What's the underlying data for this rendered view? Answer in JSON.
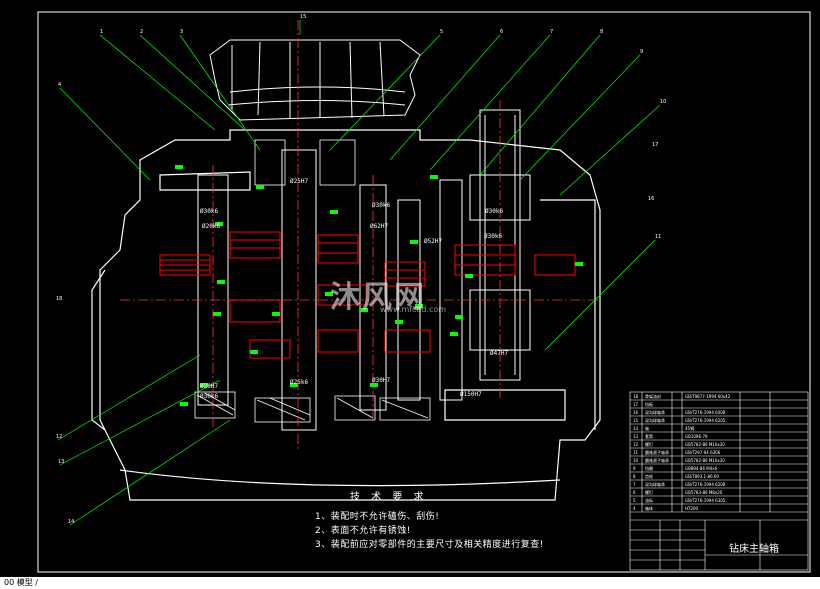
{
  "drawing": {
    "title": "钻床主轴箱",
    "tech_requirements_title": "技 术 要 求",
    "tech_requirements": [
      "1、装配时不允许磕伤、刮伤!",
      "2、表面不允许有锈蚀!",
      "3、装配前应对零部件的主要尺寸及相关精度进行复查!"
    ],
    "dimensions": [
      "Ø25H7",
      "Ø30k6",
      "Ø20k6",
      "Ø30k6",
      "Ø62H7",
      "Ø30k6",
      "Ø52H7",
      "Ø30k6",
      "Ø47H7",
      "Ø20H7",
      "Ø25k6",
      "Ø30H7",
      "Ø30k6",
      "Ø150H7"
    ],
    "part_callouts": [
      "1",
      "2",
      "3",
      "4",
      "5",
      "6",
      "7",
      "8",
      "9",
      "10",
      "11",
      "12",
      "13",
      "14",
      "15",
      "16",
      "17",
      "18"
    ]
  },
  "watermark": {
    "text": "沐风网",
    "sub": "www.mfcad.com"
  },
  "status_bar": {
    "text": "00 模型 / "
  },
  "colors": {
    "background": "#000000",
    "outline": "#ffffff",
    "gear": "#ff0000",
    "leader": "#00ff00",
    "center": "#ff3333"
  }
}
